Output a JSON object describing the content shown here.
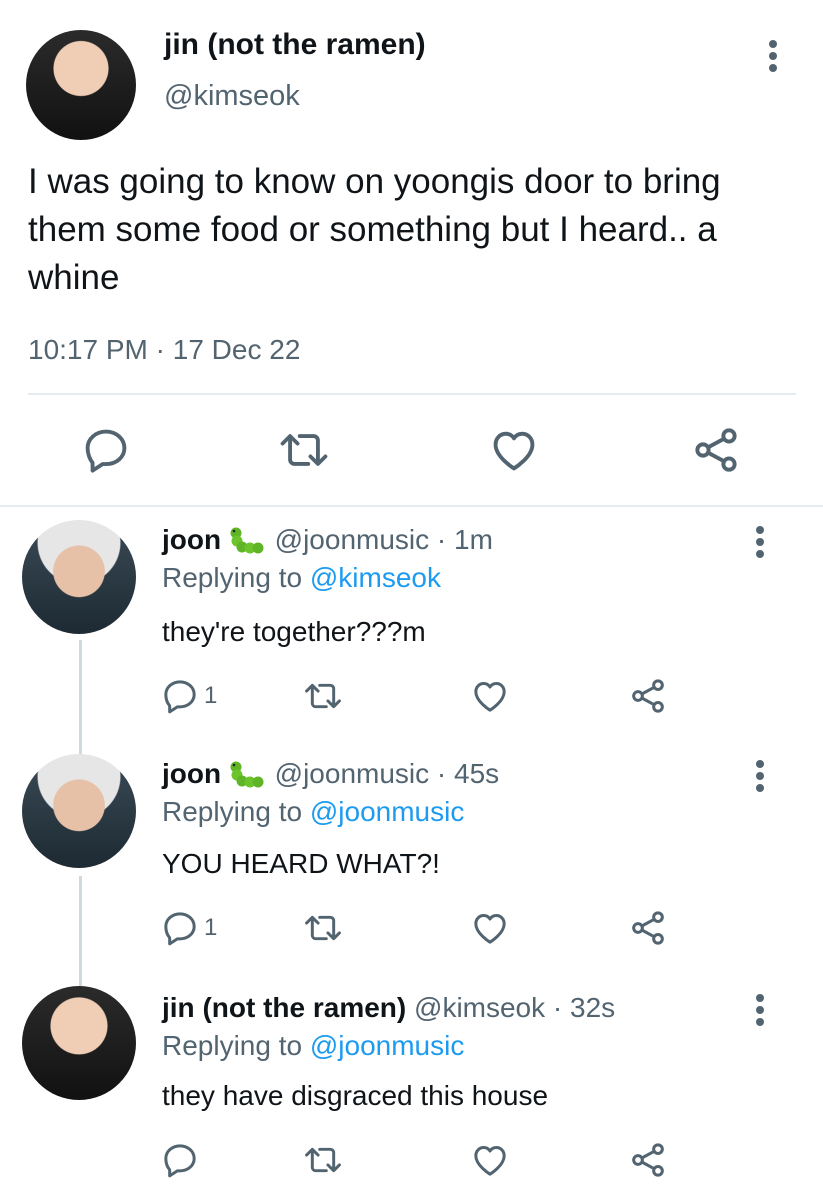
{
  "main_tweet": {
    "name": "jin (not the ramen)",
    "handle": "@kimseok",
    "text": "I was going to know on yoongis door to bring them some food or something but I heard.. a whine",
    "time": "10:17 PM",
    "date": "17 Dec 22",
    "separator": "·",
    "actions": [
      "reply-icon",
      "retweet-icon",
      "like-icon",
      "share-icon"
    ]
  },
  "replies": [
    {
      "name": "joon",
      "name_emoji": "caterpillar-emoji",
      "handle": "@joonmusic",
      "separator": "·",
      "age": "1m",
      "replying_prefix": "Replying to",
      "replying_to": "@kimseok",
      "text": "they're together???m",
      "reply_count": "1"
    },
    {
      "name": "joon",
      "name_emoji": "caterpillar-emoji",
      "handle": "@joonmusic",
      "separator": "·",
      "age": "45s",
      "replying_prefix": "Replying to",
      "replying_to": "@joonmusic",
      "text": "YOU HEARD WHAT?!",
      "reply_count": "1"
    },
    {
      "name": "jin (not the ramen)",
      "handle": "@kimseok",
      "separator": "·",
      "age": "32s",
      "replying_prefix": "Replying to",
      "replying_to": "@joonmusic",
      "text": "they have disgraced this house",
      "reply_count": ""
    }
  ],
  "colors": {
    "text": "#0f1419",
    "secondary": "#536471",
    "link": "#1d9bf0",
    "divider": "#e7ecf0",
    "thread_line": "#cfd9de"
  }
}
